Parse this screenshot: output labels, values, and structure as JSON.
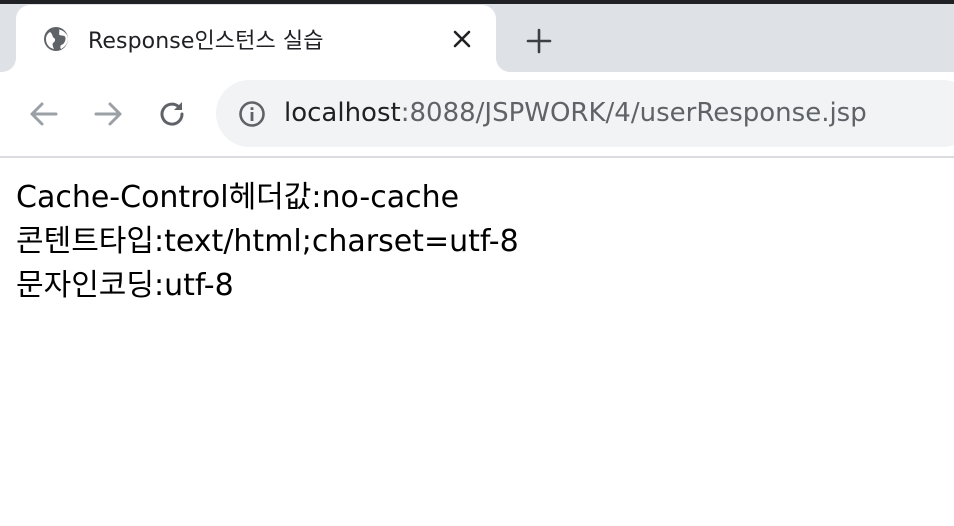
{
  "browser": {
    "tab": {
      "title": "Response인스턴스 실습",
      "favicon": "globe-icon"
    },
    "new_tab_icon": "plus-icon",
    "nav": {
      "back_icon": "arrow-left-icon",
      "forward_icon": "arrow-right-icon",
      "reload_icon": "reload-icon"
    },
    "address_bar": {
      "info_icon": "info-icon",
      "url_host": "localhost",
      "url_rest": ":8088/JSPWORK/4/userResponse.jsp"
    }
  },
  "page": {
    "lines": [
      "Cache-Control헤더값:no-cache",
      "콘텐트타입:text/html;charset=utf-8",
      "문자인코딩:utf-8"
    ]
  },
  "colors": {
    "tabstrip_bg": "#dee1e6",
    "omnibox_bg": "#f1f3f4",
    "icon_gray": "#5f6368",
    "disabled_icon": "#9aa0a6"
  }
}
